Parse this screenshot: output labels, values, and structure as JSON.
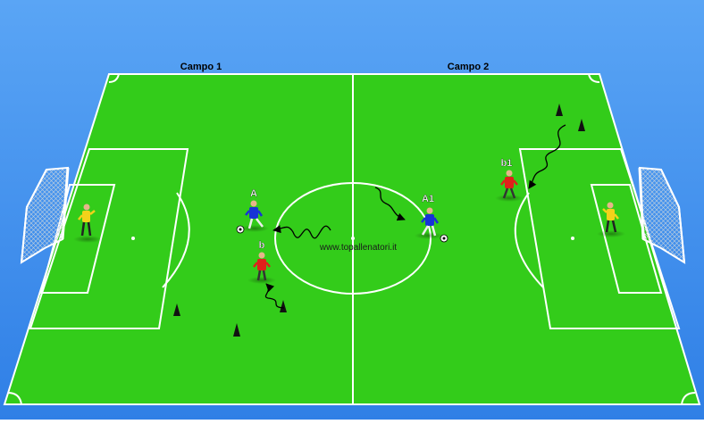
{
  "field_labels": {
    "left": "Campo  1",
    "right": "Campo  2"
  },
  "players": {
    "A": "A",
    "b": "b",
    "A1": "A1",
    "b1": "b1"
  },
  "watermark": "www.topallenatori.it",
  "colors": {
    "background": "#3f8ff0",
    "grass": "#33cc1a",
    "lines": "#ffffff",
    "team_blue": "#1733d6",
    "team_red": "#e0201b",
    "goalkeeper": "#f2d21a",
    "cone": "#111111"
  },
  "icons": {
    "goal": "goal-net-icon",
    "cone": "cone-icon",
    "ball": "soccer-ball-icon",
    "player": "player-figure-icon"
  }
}
